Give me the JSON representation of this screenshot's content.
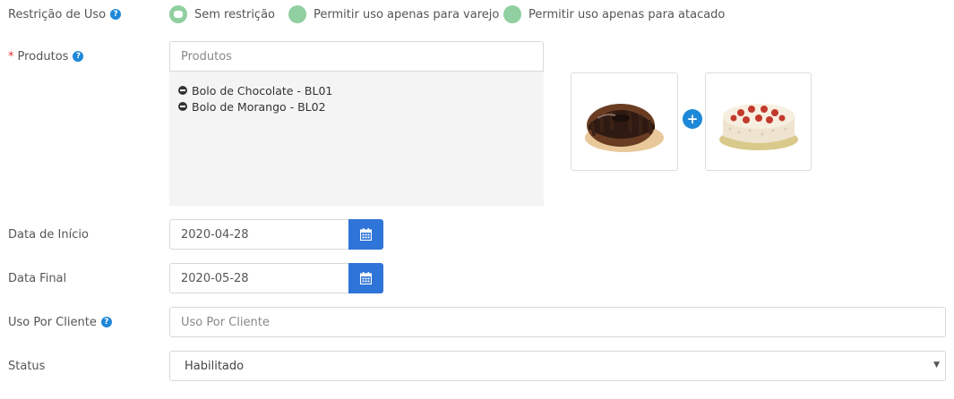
{
  "restricao": {
    "label": "Restrição de Uso",
    "help_icon": "question-circle-icon",
    "options": [
      {
        "label": "Sem restrição",
        "selected": true
      },
      {
        "label": "Permitir uso apenas para varejo",
        "selected": false
      },
      {
        "label": "Permitir uso apenas para atacado",
        "selected": false
      }
    ],
    "radio_color": "#8fcfa0"
  },
  "produtos": {
    "required_mark": "*",
    "label": "Produtos",
    "placeholder": "Produtos",
    "items": [
      {
        "text": "Bolo de Chocolate - BL01",
        "icon": "minus-circle-icon"
      },
      {
        "text": "Bolo de Morango - BL02",
        "icon": "minus-circle-icon"
      }
    ],
    "images": [
      "chocolate-bundt-cake",
      "strawberry-cream-cake"
    ],
    "add_icon": "plus-circle-icon"
  },
  "data_inicio": {
    "label": "Data de Início",
    "value": "2020-04-28",
    "icon": "calendar-icon"
  },
  "data_final": {
    "label": "Data Final",
    "value": "2020-05-28",
    "icon": "calendar-icon"
  },
  "uso_cliente": {
    "label": "Uso Por Cliente",
    "placeholder": "Uso Por Cliente",
    "help_icon": "question-circle-icon"
  },
  "status": {
    "label": "Status",
    "value": "Habilitado",
    "icon": "caret-down-icon"
  },
  "colors": {
    "accent": "#2f74d8",
    "help": "#1e88d8",
    "required": "#e8312f",
    "listbox": "#f4f4f4"
  }
}
